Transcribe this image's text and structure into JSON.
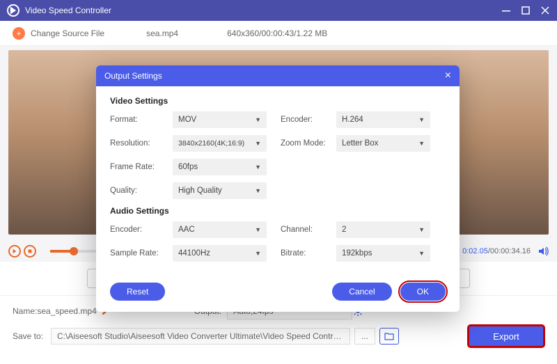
{
  "titlebar": {
    "title": "Video Speed Controller"
  },
  "toolbar": {
    "change_source": "Change Source File",
    "filename": "sea.mp4",
    "fileinfo": "640x360/00:00:43/1.22 MB"
  },
  "playback": {
    "current": "0:02.05",
    "total": "/00:00:34.16"
  },
  "dialog": {
    "title": "Output Settings",
    "video_section": "Video Settings",
    "audio_section": "Audio Settings",
    "labels": {
      "format": "Format:",
      "encoder": "Encoder:",
      "resolution": "Resolution:",
      "zoom_mode": "Zoom Mode:",
      "frame_rate": "Frame Rate:",
      "quality": "Quality:",
      "channel": "Channel:",
      "sample_rate": "Sample Rate:",
      "bitrate": "Bitrate:"
    },
    "values": {
      "format": "MOV",
      "video_encoder": "H.264",
      "resolution": "3840x2160(4K;16:9)",
      "zoom_mode": "Letter Box",
      "frame_rate": "60fps",
      "quality": "High Quality",
      "audio_encoder": "AAC",
      "channel": "2",
      "sample_rate": "44100Hz",
      "bitrate": "192kbps"
    },
    "buttons": {
      "reset": "Reset",
      "cancel": "Cancel",
      "ok": "OK"
    }
  },
  "bottom": {
    "name_label": "Name:",
    "name_value": "sea_speed.mp4",
    "output_label": "Output:",
    "output_value": "Auto;24fps",
    "saveto_label": "Save to:",
    "saveto_path": "C:\\Aiseesoft Studio\\Aiseesoft Video Converter Ultimate\\Video Speed Controller",
    "more": "...",
    "export": "Export"
  }
}
